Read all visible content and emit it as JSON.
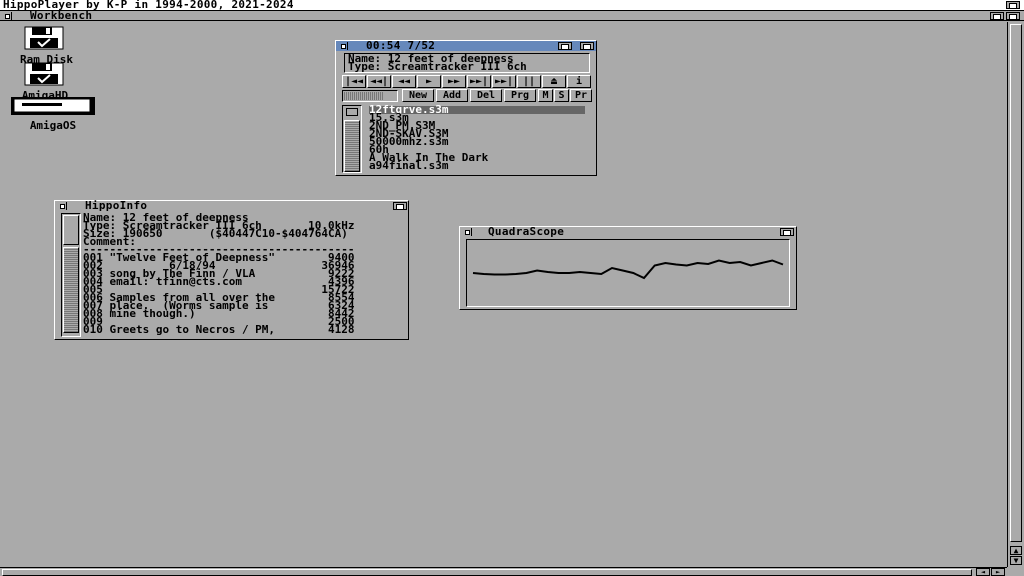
{
  "screen": {
    "title": "HippoPlayer by K-P in 1994-2000, 2021-2024"
  },
  "workbench": {
    "title": "Workbench"
  },
  "desktop_icons": [
    {
      "label": "Ram Disk",
      "icon": "disk-icon"
    },
    {
      "label": "AmigaHD",
      "icon": "disk-icon"
    },
    {
      "label": "AmigaOS",
      "icon": "drive-icon"
    }
  ],
  "player": {
    "title": "00:54  7/52",
    "name_line": "Name: 12 feet of deepness",
    "type_line": "Type: Screamtracker III 6ch",
    "transport": [
      "|◄◄",
      "◄◄|",
      "◄◄",
      "►",
      "►►",
      "►►|",
      "►►|",
      "||",
      "⏏",
      "i"
    ],
    "actions": [
      "New",
      "Add",
      "Del",
      "Prg",
      "M",
      "S",
      "Pr"
    ],
    "files": [
      "12ftgrve.s3m",
      "15.s3m",
      "2ND_PM.S3M",
      "2ND-SKAV.S3M",
      "50000mhz.s3m",
      "60h",
      "A Walk In The Dark",
      "a94final.s3m"
    ]
  },
  "info": {
    "title": "HippoInfo",
    "lines": [
      "Name: 12 feet of deepness",
      "Type: Screamtracker III 6ch       10.0kHz",
      "Size: 190650       ($40447C10-$404764CA)",
      "Comment:",
      "-----------------------------------------",
      "001 \"Twelve Feet of Deepness\"        9400",
      "002          6/18/94                36946",
      "003 song by The Finn / VLA           9222",
      "004 email: tfinn@cts.com             4396",
      "005                                 15722",
      "006 Samples from all over the        8554",
      "007 place.  (Worms sample is         6324",
      "008 mine though.)                    8442",
      "009                                  2500",
      "010 Greets go to Necros / PM,        4128"
    ]
  },
  "scope": {
    "title": "QuadraScope",
    "level": [
      0.5,
      0.52,
      0.53,
      0.53,
      0.52,
      0.5,
      0.45,
      0.48,
      0.5,
      0.5,
      0.48,
      0.5,
      0.52,
      0.4,
      0.45,
      0.5,
      0.6,
      0.35,
      0.3,
      0.33,
      0.35,
      0.3,
      0.32,
      0.25,
      0.3,
      0.28,
      0.35,
      0.3,
      0.25,
      0.33
    ]
  }
}
